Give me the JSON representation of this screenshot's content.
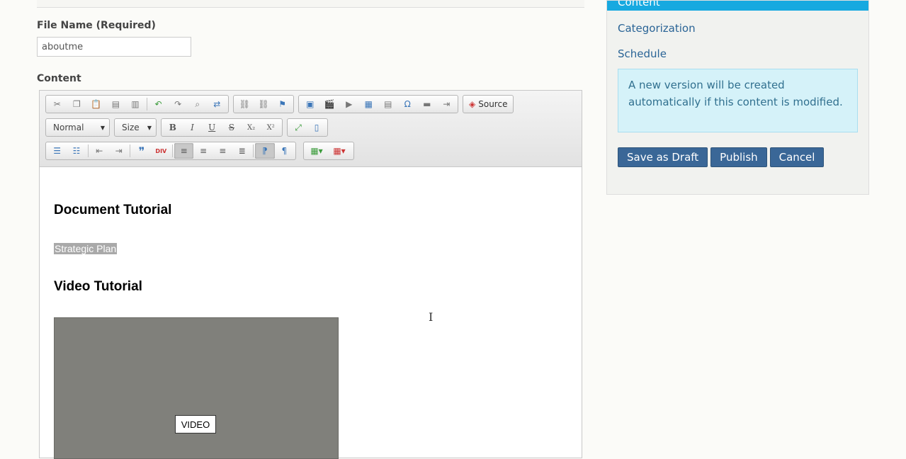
{
  "form": {
    "file_name_label": "File Name (Required)",
    "file_name_value": "aboutme",
    "content_label": "Content"
  },
  "toolbar": {
    "format_combo": "Normal",
    "size_combo": "Size",
    "source_label": "Source",
    "bold": "B",
    "italic": "I",
    "underline": "U",
    "strike": "S",
    "subscript": "X₂",
    "superscript": "X²",
    "omega": "Ω",
    "quote": "❞",
    "div": "DIV"
  },
  "editor": {
    "heading1": "Document Tutorial",
    "link_text": "Strategic Plan",
    "heading2": "Video Tutorial",
    "video_label": "VIDEO"
  },
  "sidebar": {
    "active_tab": "Content",
    "links": [
      "Categorization",
      "Schedule"
    ],
    "notice": "A new version will be created automatically if this content is modified.",
    "buttons": {
      "save_draft": "Save as Draft",
      "publish": "Publish",
      "cancel": "Cancel"
    }
  },
  "colors": {
    "accent": "#17a9e0",
    "button": "#3a6797",
    "notice_bg": "#d5f2f9",
    "link": "#2a6496"
  }
}
